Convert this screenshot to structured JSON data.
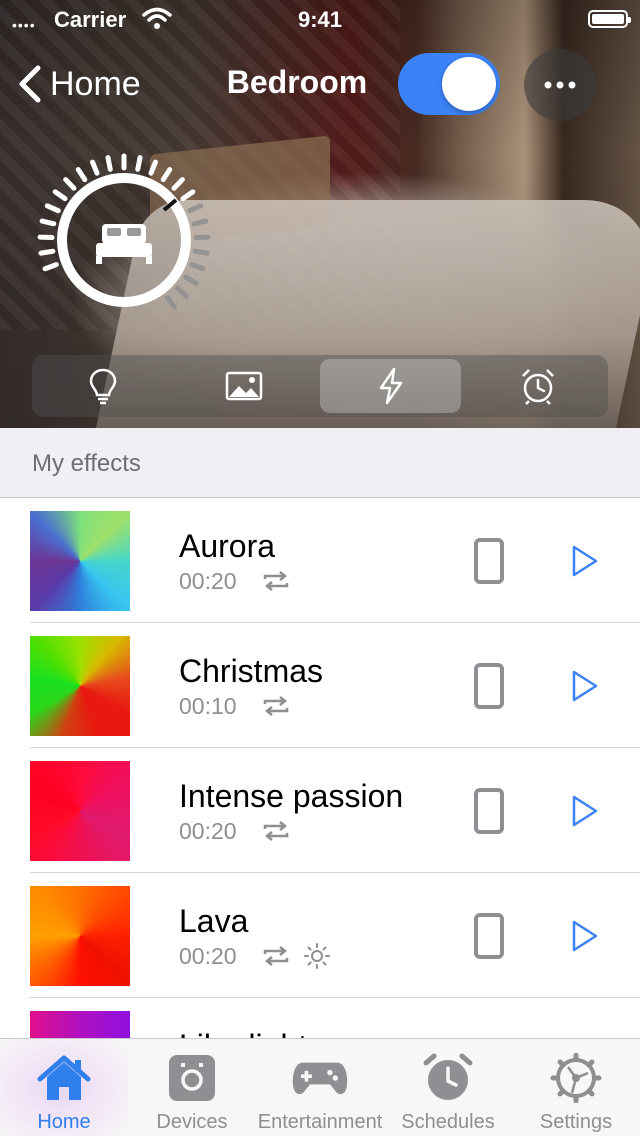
{
  "status_bar": {
    "carrier": "Carrier",
    "time": "9:41"
  },
  "nav": {
    "back_label": "Home",
    "title": "Bedroom",
    "power_on": true
  },
  "colors": {
    "accent": "#3b82f6",
    "toggle_on": "#3b82f6",
    "active_tab": "#2f80ed",
    "muted": "#8e8e93"
  },
  "mode_tabs": [
    {
      "name": "lights",
      "icon": "bulb-icon",
      "active": false
    },
    {
      "name": "scenes",
      "icon": "picture-icon",
      "active": false
    },
    {
      "name": "effects",
      "icon": "bolt-icon",
      "active": true
    },
    {
      "name": "alarms",
      "icon": "alarm-icon",
      "active": false
    }
  ],
  "section": {
    "title": "My effects"
  },
  "effects": [
    {
      "name": "Aurora",
      "duration": "00:20",
      "loop": true,
      "brightness": false
    },
    {
      "name": "Christmas",
      "duration": "00:10",
      "loop": true,
      "brightness": false
    },
    {
      "name": "Intense passion",
      "duration": "00:20",
      "loop": true,
      "brightness": false
    },
    {
      "name": "Lava",
      "duration": "00:20",
      "loop": true,
      "brightness": true
    },
    {
      "name": "Lila dight",
      "duration": "",
      "loop": false,
      "brightness": false
    }
  ],
  "tab_bar": [
    {
      "label": "Home",
      "icon": "home-icon",
      "active": true
    },
    {
      "label": "Devices",
      "icon": "devices-icon",
      "active": false
    },
    {
      "label": "Entertainment",
      "icon": "gamepad-icon",
      "active": false
    },
    {
      "label": "Schedules",
      "icon": "clock-icon",
      "active": false
    },
    {
      "label": "Settings",
      "icon": "gear-icon",
      "active": false
    }
  ]
}
